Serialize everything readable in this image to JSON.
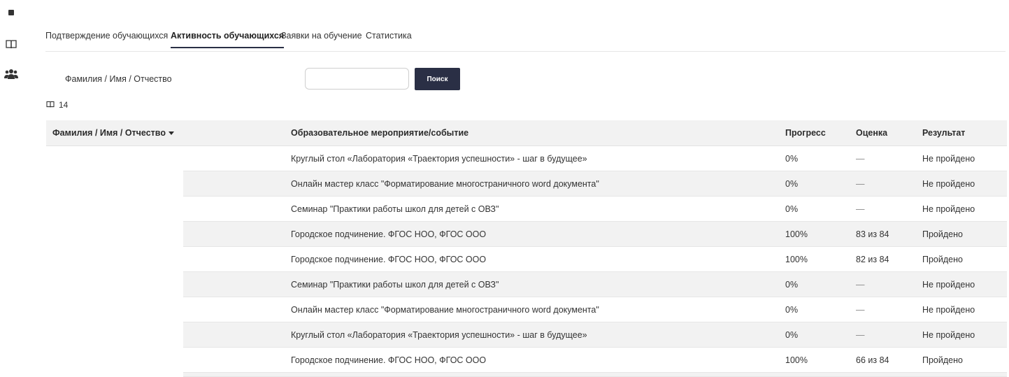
{
  "sidebar": {
    "items": [
      {
        "icon": "square-icon"
      },
      {
        "icon": "book-icon"
      },
      {
        "icon": "users-icon"
      }
    ]
  },
  "tabs": [
    {
      "label": "Подтверждение обучающихся",
      "active": false
    },
    {
      "label": "Активность обучающихся",
      "active": true
    },
    {
      "label": "Заявки на обучение",
      "active": false
    },
    {
      "label": "Статистика",
      "active": false
    }
  ],
  "filter": {
    "label": "Фамилия / Имя / Отчество",
    "input_value": "",
    "button_label": "Поиск"
  },
  "count": {
    "icon": "book-icon",
    "value": "14"
  },
  "table": {
    "headers": {
      "name": "Фамилия / Имя / Отчество",
      "event": "Образовательное мероприятие/событие",
      "progress": "Прогресс",
      "grade": "Оценка",
      "result": "Результат"
    },
    "rows": [
      {
        "name": "",
        "event": "Круглый стол «Лаборатория «Траектория успешности» - шаг в будущее»",
        "progress": "0%",
        "grade": "—",
        "result": "Не пройдено"
      },
      {
        "name": "",
        "event": "Онлайн мастер класс \"Форматирование многостраничного word документа\"",
        "progress": "0%",
        "grade": "—",
        "result": "Не пройдено"
      },
      {
        "name": "",
        "event": "Семинар \"Практики работы школ для детей с ОВЗ\"",
        "progress": "0%",
        "grade": "—",
        "result": "Не пройдено"
      },
      {
        "name": "",
        "event": "Городское подчинение. ФГОС НОО, ФГОС ООО",
        "progress": "100%",
        "grade": "83 из 84",
        "result": "Пройдено"
      },
      {
        "name": "",
        "event": "Городское подчинение. ФГОС НОО, ФГОС ООО",
        "progress": "100%",
        "grade": "82 из 84",
        "result": "Пройдено"
      },
      {
        "name": "",
        "event": "Семинар \"Практики работы школ для детей с ОВЗ\"",
        "progress": "0%",
        "grade": "—",
        "result": "Не пройдено"
      },
      {
        "name": "",
        "event": "Онлайн мастер класс \"Форматирование многостраничного word документа\"",
        "progress": "0%",
        "grade": "—",
        "result": "Не пройдено"
      },
      {
        "name": "",
        "event": "Круглый стол «Лаборатория «Траектория успешности» - шаг в будущее»",
        "progress": "0%",
        "grade": "—",
        "result": "Не пройдено"
      },
      {
        "name": "",
        "event": "Городское подчинение. ФГОС НОО, ФГОС ООО",
        "progress": "100%",
        "grade": "66 из 84",
        "result": "Пройдено"
      }
    ]
  },
  "colors": {
    "accent": "#2a2f45",
    "stripe": "#f2f2f2",
    "border": "#e6e6e6"
  }
}
